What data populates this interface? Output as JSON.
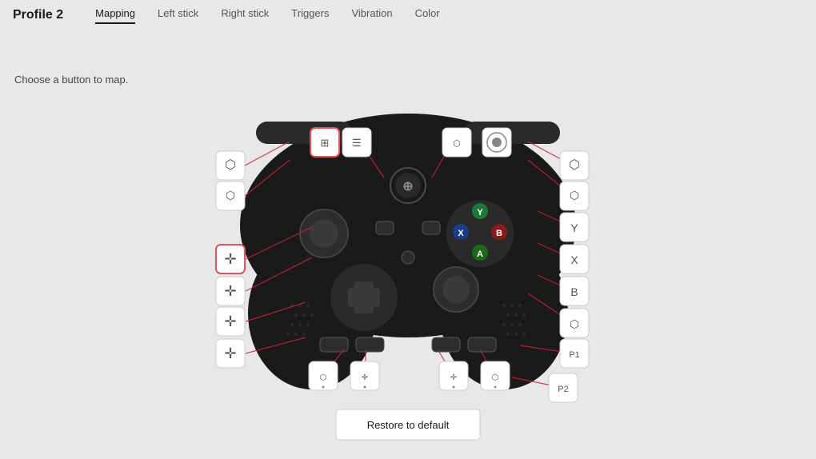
{
  "header": {
    "title": "Profile 2",
    "tabs": [
      {
        "id": "mapping",
        "label": "Mapping",
        "active": true
      },
      {
        "id": "left-stick",
        "label": "Left stick",
        "active": false
      },
      {
        "id": "right-stick",
        "label": "Right stick",
        "active": false
      },
      {
        "id": "triggers",
        "label": "Triggers",
        "active": false
      },
      {
        "id": "vibration",
        "label": "Vibration",
        "active": false
      },
      {
        "id": "color",
        "label": "Color",
        "active": false
      }
    ]
  },
  "instruction": "Choose a button to map.",
  "restore_button": "Restore to default",
  "buttons": {
    "lb": "⬛",
    "rb": "⬛",
    "lt": "⬛",
    "rt": "⬛",
    "view": "⬛",
    "menu": "⬛",
    "left_stick_up": "✛",
    "left_stick_down": "✛",
    "dpad_up": "✛",
    "dpad_down": "✛",
    "y_btn": "Y",
    "x_btn": "X",
    "b_btn": "B",
    "a_btn": "A",
    "right_stick": "⬛",
    "paddle1": "⬛",
    "paddle2": "⬛",
    "paddle3": "⬛",
    "paddle4": "⬛"
  }
}
